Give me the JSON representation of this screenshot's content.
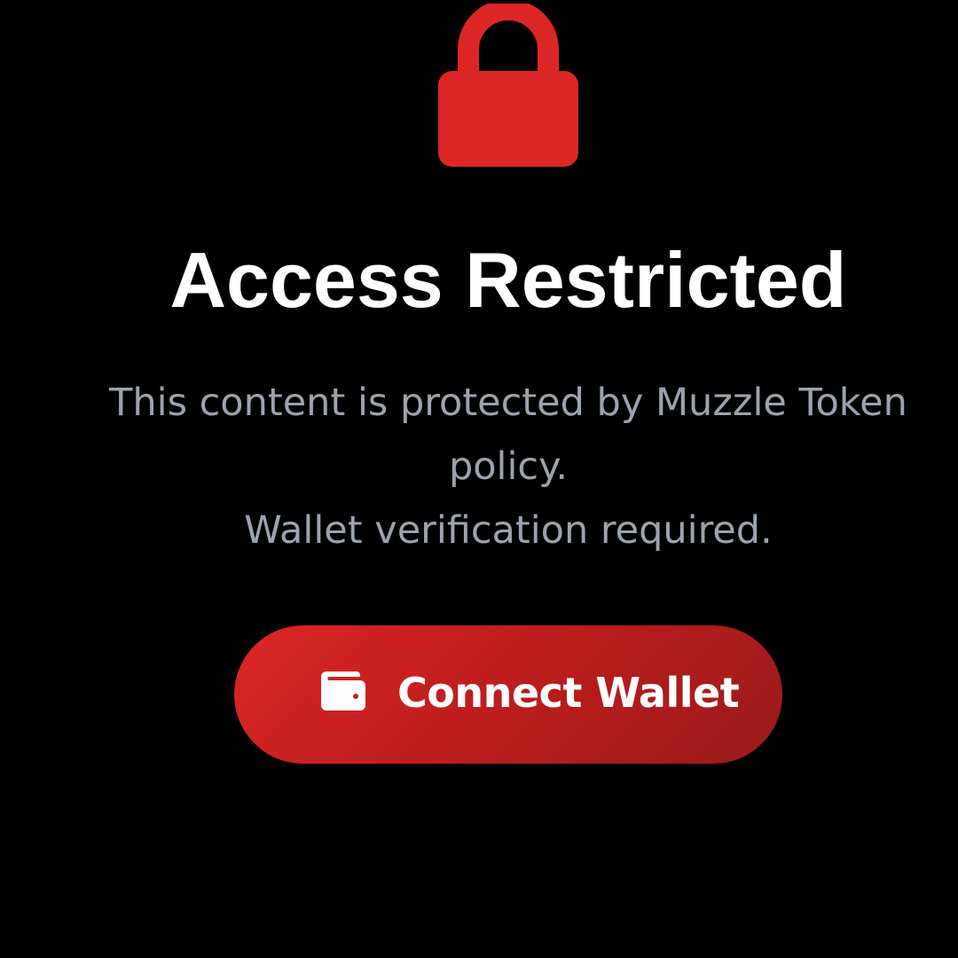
{
  "page": {
    "background_color": "#000000",
    "accent_color": "#dc2626"
  },
  "lock": {
    "icon": "lock-icon",
    "color": "#dc2626"
  },
  "title": "Access Restricted",
  "message": {
    "line1": "This content is protected by Muzzle Token",
    "line2": "policy.",
    "line3": "Wallet verification required.",
    "color": "#9ca3af"
  },
  "connect_button": {
    "icon": "wallet-icon",
    "label": "Connect Wallet"
  }
}
